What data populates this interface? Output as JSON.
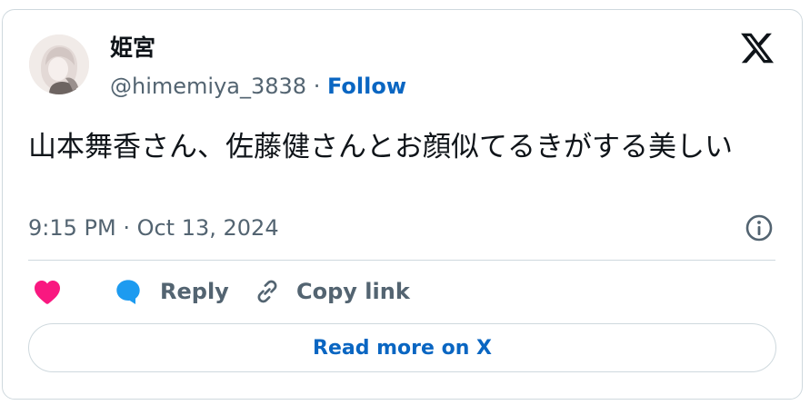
{
  "user": {
    "display_name": "姫宮",
    "handle": "@himemiya_3838",
    "separator": "·",
    "follow_label": "Follow"
  },
  "tweet": {
    "text": "山本舞香さん、佐藤健さんとお顔似てるきがする美しい",
    "timestamp": "9:15 PM · Oct 13, 2024"
  },
  "actions": {
    "reply_label": "Reply",
    "copy_link_label": "Copy link"
  },
  "read_more_label": "Read more on X",
  "colors": {
    "like": "#f91880",
    "reply": "#1d9bf0",
    "link": "#0a66c2",
    "muted": "#536471",
    "border": "#cfd9de"
  },
  "icons": [
    "x-logo-icon",
    "info-icon",
    "heart-icon",
    "reply-bubble-icon",
    "link-icon"
  ]
}
